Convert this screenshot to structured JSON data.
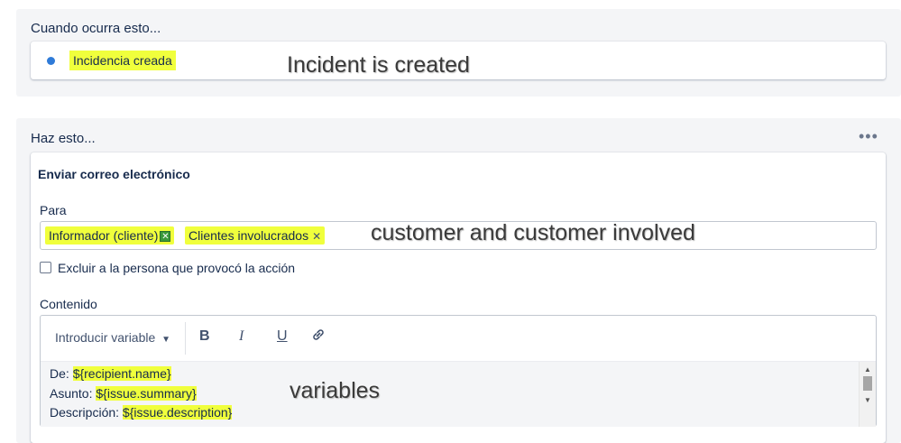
{
  "trigger": {
    "title": "Cuando ocurra esto...",
    "item_label": "Incidencia creada",
    "annotation": "Incident is created"
  },
  "action": {
    "title": "Haz esto...",
    "more_label": "•••",
    "card_title": "Enviar correo electrónico",
    "to_label": "Para",
    "recipients": [
      "Informador (cliente)",
      "Clientes involucrados"
    ],
    "recipients_annotation": "customer and customer involved",
    "exclude_label": "Excluir a la persona que provocó la acción",
    "content_label": "Contenido",
    "insert_variable_label": "Introducir variable",
    "toolbar": {
      "bold": "B",
      "italic": "I",
      "underline": "U"
    },
    "content_lines": [
      {
        "prefix": "De: ",
        "variable": "${recipient.name}"
      },
      {
        "prefix": "Asunto: ",
        "variable": "${issue.summary}"
      },
      {
        "prefix": "Descripción: ",
        "variable": "${issue.description}"
      }
    ],
    "variables_annotation": "variables"
  },
  "colors": {
    "highlight": "#f0ff3c",
    "dot": "#2f7bd8",
    "panel": "#f4f5f7",
    "text": "#172b4d"
  },
  "icons": {
    "trigger_dot": "status-dot",
    "link": "link-icon",
    "dropdown": "chevron-down-icon"
  }
}
